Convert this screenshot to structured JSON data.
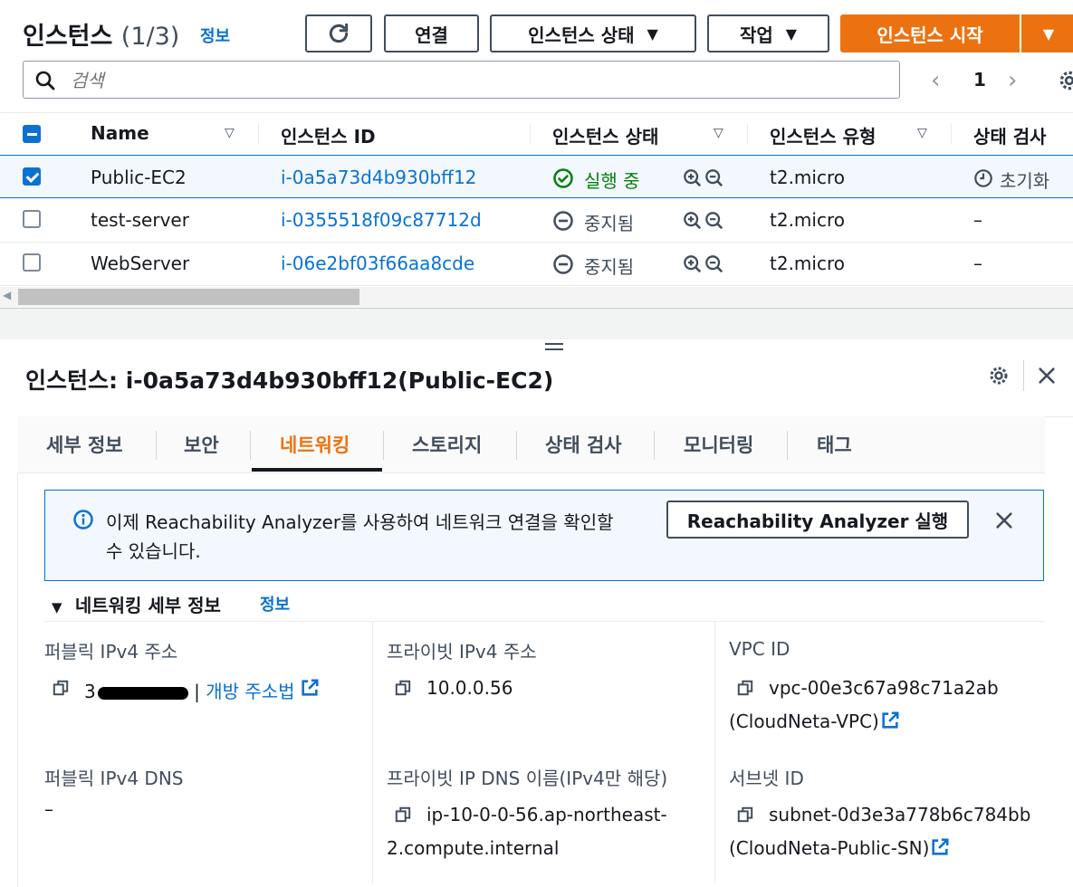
{
  "header": {
    "title": "인스턴스",
    "count": "(1/3)",
    "info": "정보",
    "connect_label": "연결",
    "instance_state_label": "인스턴스 상태",
    "actions_label": "작업",
    "launch_label": "인스턴스 시작"
  },
  "search": {
    "placeholder": "검색"
  },
  "pagination": {
    "page": "1"
  },
  "table": {
    "columns": [
      "Name",
      "인스턴스 ID",
      "인스턴스 상태",
      "인스턴스 유형",
      "상태 검사"
    ],
    "rows": [
      {
        "name": "Public-EC2",
        "id": "i-0a5a73d4b930bff12",
        "state": "실행 중",
        "state_kind": "running",
        "type": "t2.micro",
        "check": "초기화",
        "selected": true
      },
      {
        "name": "test-server",
        "id": "i-0355518f09c87712d",
        "state": "중지됨",
        "state_kind": "stopped",
        "type": "t2.micro",
        "check": "–",
        "selected": false
      },
      {
        "name": "WebServer",
        "id": "i-06e2bf03f66aa8cde",
        "state": "중지됨",
        "state_kind": "stopped",
        "type": "t2.micro",
        "check": "–",
        "selected": false
      }
    ]
  },
  "detail": {
    "title": "인스턴스: i-0a5a73d4b930bff12(Public-EC2)",
    "tabs": [
      "세부 정보",
      "보안",
      "네트워킹",
      "스토리지",
      "상태 검사",
      "모니터링",
      "태그"
    ],
    "active_tab": "네트워킹",
    "alert": {
      "text_line1": "이제 Reachability Analyzer를 사용하여 네트워크 연결을 확인할",
      "text_line2": "수 있습니다.",
      "button": "Reachability Analyzer 실행"
    },
    "section": {
      "title": "네트워킹 세부 정보",
      "info": "정보"
    },
    "fields": {
      "public_ipv4_label": "퍼블릭 IPv4 주소",
      "public_ipv4_value_prefix": "3",
      "public_ipv4_link": "개방 주소법",
      "private_ipv4_label": "프라이빗 IPv4 주소",
      "private_ipv4_value": "10.0.0.56",
      "vpc_label": "VPC ID",
      "vpc_value": "vpc-00e3c67a98c71a2ab",
      "vpc_name": "(CloudNeta-VPC)",
      "public_dns_label": "퍼블릭 IPv4 DNS",
      "public_dns_value": "–",
      "private_dns_label": "프라이빗 IP DNS 이름(IPv4만 해당)",
      "private_dns_line1": "ip-10-0-0-56.ap-northeast-",
      "private_dns_line2": "2.compute.internal",
      "subnet_label": "서브넷 ID",
      "subnet_value": "subnet-0d3e3a778b6c784bb",
      "subnet_name": "(CloudNeta-Public-SN)"
    }
  },
  "colors": {
    "accent": "#ec7211",
    "link": "#0972d3",
    "success": "#037f0c",
    "muted": "#414d5c"
  }
}
